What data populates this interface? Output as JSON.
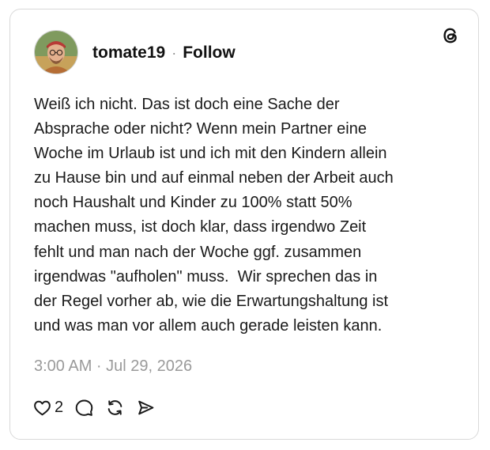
{
  "post": {
    "username": "tomate19",
    "separator": "·",
    "follow_label": "Follow",
    "text": "Weiß ich nicht. Das ist doch eine Sache der\nAbsprache oder nicht? Wenn mein Partner eine\nWoche im Urlaub ist und ich mit den Kindern allein\nzu Hause bin und auf einmal neben der Arbeit auch\nnoch Haushalt und Kinder zu 100% statt 50%\nmachen muss, ist doch klar, dass irgendwo Zeit\nfehlt und man nach der Woche ggf. zusammen\nirgendwas \"aufholen\" muss.  Wir sprechen das in\nder Regel vorher ab, wie die Erwartungshaltung ist\nund was man vor allem auch gerade leisten kann.",
    "timestamp": "3:00 AM · Jul 29, 2026",
    "like_count": "2"
  },
  "icons": {
    "brand": "threads-logo-icon",
    "like": "heart-icon",
    "reply": "comment-bubble-icon",
    "repost": "repost-arrows-icon",
    "share": "send-icon"
  },
  "colors": {
    "text": "#1a1a1a",
    "muted": "#9a9a9a",
    "border": "#d9d9d9"
  }
}
